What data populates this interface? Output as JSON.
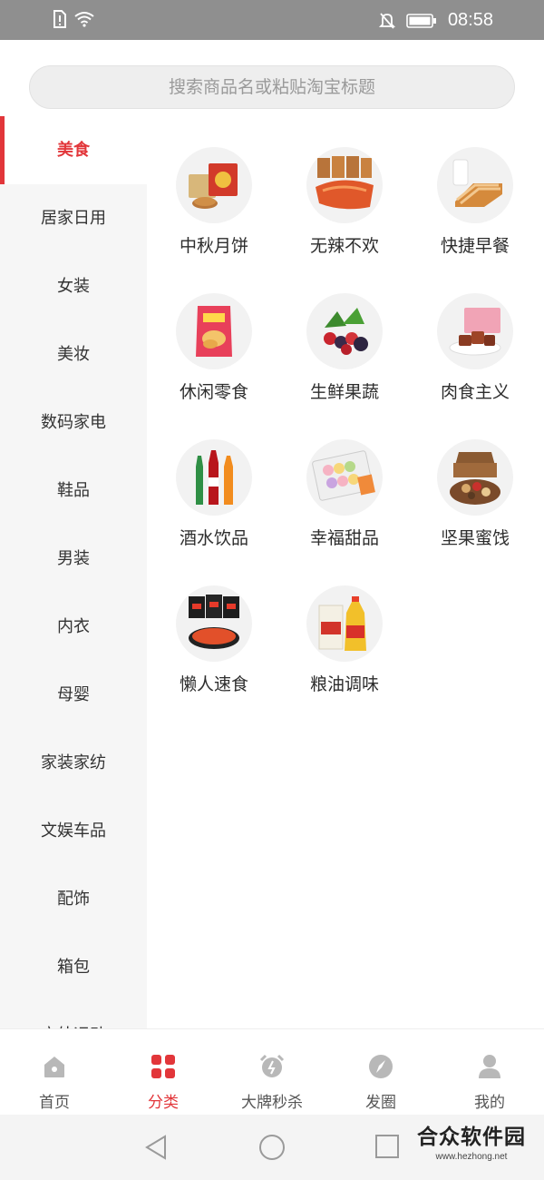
{
  "status_bar": {
    "time": "08:58"
  },
  "search": {
    "placeholder": "搜索商品名或粘贴淘宝标题"
  },
  "sidebar": {
    "items": [
      {
        "label": "美食",
        "active": true
      },
      {
        "label": "居家日用"
      },
      {
        "label": "女装"
      },
      {
        "label": "美妆"
      },
      {
        "label": "数码家电"
      },
      {
        "label": "鞋品"
      },
      {
        "label": "男装"
      },
      {
        "label": "内衣"
      },
      {
        "label": "母婴"
      },
      {
        "label": "家装家纺"
      },
      {
        "label": "文娱车品"
      },
      {
        "label": "配饰"
      },
      {
        "label": "箱包"
      },
      {
        "label": "户外运动"
      }
    ]
  },
  "categories": [
    {
      "label": "中秋月饼",
      "icon": "mooncake-icon"
    },
    {
      "label": "无辣不欢",
      "icon": "spicy-snack-icon"
    },
    {
      "label": "快捷早餐",
      "icon": "bread-milk-icon"
    },
    {
      "label": "休闲零食",
      "icon": "chips-icon"
    },
    {
      "label": "生鲜果蔬",
      "icon": "berries-icon"
    },
    {
      "label": "肉食主义",
      "icon": "meat-icon"
    },
    {
      "label": "酒水饮品",
      "icon": "drinks-icon"
    },
    {
      "label": "幸福甜品",
      "icon": "macaron-icon"
    },
    {
      "label": "坚果蜜饯",
      "icon": "nuts-icon"
    },
    {
      "label": "懒人速食",
      "icon": "instant-noodle-icon"
    },
    {
      "label": "粮油调味",
      "icon": "rice-oil-icon"
    }
  ],
  "tabbar": {
    "items": [
      {
        "label": "首页",
        "icon": "home-icon"
      },
      {
        "label": "分类",
        "icon": "category-icon",
        "active": true
      },
      {
        "label": "大牌秒杀",
        "icon": "alarm-clock-icon"
      },
      {
        "label": "发圈",
        "icon": "compass-icon"
      },
      {
        "label": "我的",
        "icon": "user-icon"
      }
    ]
  },
  "watermark": {
    "title": "合众软件园",
    "url": "www.hezhong.net"
  },
  "colors": {
    "accent": "#e2363a",
    "status_bar": "#8f8f8f",
    "sidebar_bg": "#f6f6f6"
  }
}
